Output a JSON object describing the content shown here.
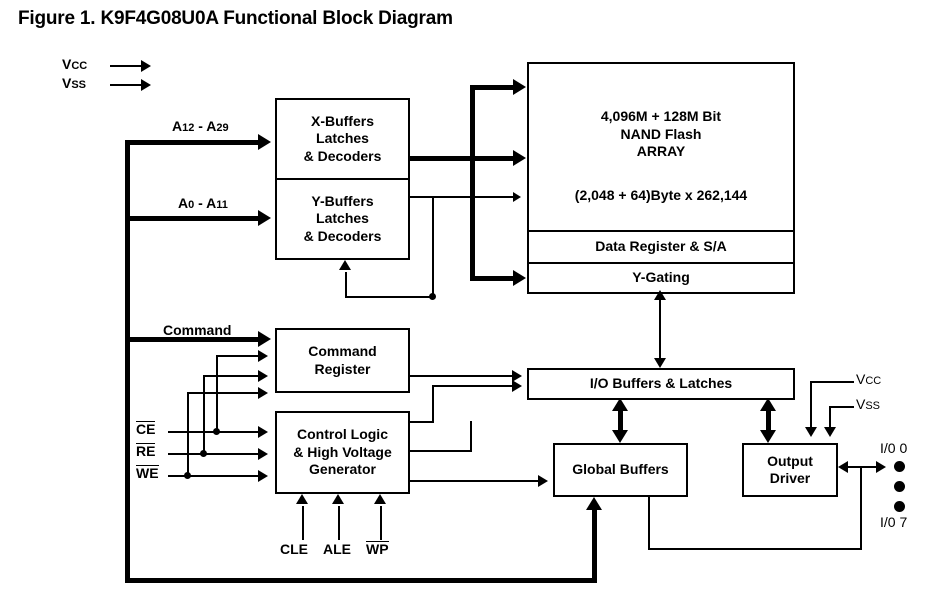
{
  "figure": {
    "title": "Figure 1. K9F4G08U0A Functional Block Diagram"
  },
  "power_inputs": [
    {
      "name": "vcc-input",
      "label": "Vcc",
      "main": "V",
      "sub": "CC"
    },
    {
      "name": "vss-input",
      "label": "Vss",
      "main": "V",
      "sub": "SS"
    }
  ],
  "address_inputs": [
    {
      "name": "address-bus-high",
      "label": "A12 - A29",
      "main1": "A",
      "sub1": "12",
      "dash": " - ",
      "main2": "A",
      "sub2": "29"
    },
    {
      "name": "address-bus-low",
      "label": "A0 - A11",
      "main1": "A",
      "sub1": "0",
      "dash": " - ",
      "main2": "A",
      "sub2": "11"
    }
  ],
  "command_input": {
    "label": "Command"
  },
  "control_inputs": [
    {
      "label": "CE",
      "overbar": true
    },
    {
      "label": "RE",
      "overbar": true
    },
    {
      "label": "WE",
      "overbar": true
    }
  ],
  "bottom_inputs": [
    {
      "label": "CLE",
      "overbar": false
    },
    {
      "label": "ALE",
      "overbar": false
    },
    {
      "label": "WP",
      "overbar": true
    }
  ],
  "blocks": {
    "x_buffers": {
      "lines": [
        "X-Buffers",
        "Latches",
        "& Decoders"
      ]
    },
    "y_buffers": {
      "lines": [
        "Y-Buffers",
        "Latches",
        "& Decoders"
      ]
    },
    "array": {
      "lines": [
        "4,096M + 128M Bit",
        "NAND Flash",
        "ARRAY"
      ],
      "capacity": "(2,048 + 64)Byte x 262,144"
    },
    "data_register": {
      "label": "Data Register & S/A"
    },
    "y_gating": {
      "label": "Y-Gating"
    },
    "io_buffers": {
      "label": "I/O Buffers & Latches"
    },
    "command_register": {
      "lines": [
        "Command",
        "Register"
      ]
    },
    "control_logic": {
      "lines": [
        "Control Logic",
        "& High Voltage",
        "Generator"
      ]
    },
    "global_buffers": {
      "label": "Global Buffers"
    },
    "output_driver": {
      "lines": [
        "Output",
        "Driver"
      ]
    }
  },
  "output_power": [
    {
      "name": "vcc-output",
      "label": "Vcc",
      "main": "V",
      "sub": "CC"
    },
    {
      "name": "vss-output",
      "label": "Vss",
      "main": "V",
      "sub": "SS"
    }
  ],
  "io_pins": {
    "first": "I/0 0",
    "last": "I/0 7",
    "dot_count": 3
  },
  "colors": {
    "line": "#000000",
    "background": "#ffffff",
    "text": "#000000"
  }
}
